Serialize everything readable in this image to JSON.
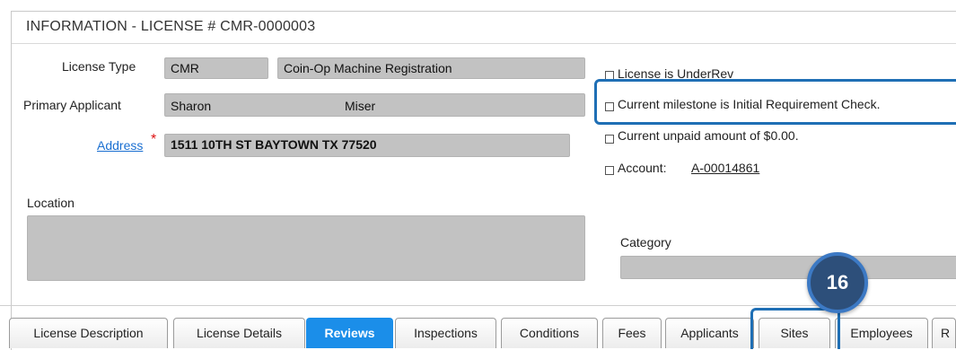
{
  "header": {
    "title": "INFORMATION - LICENSE # CMR-0000003"
  },
  "form": {
    "license_type_label": "License Type",
    "license_type_code": "CMR",
    "license_type_name": "Coin-Op Machine Registration",
    "primary_applicant_label": "Primary Applicant",
    "applicant_first": "Sharon",
    "applicant_last": "Miser",
    "address_label": "Address",
    "address_required_marker": "*",
    "address_value": "1511 10TH ST BAYTOWN TX 77520",
    "location_label": "Location",
    "location_value": "",
    "category_label": "Category",
    "category_value": ""
  },
  "status_list": {
    "item1": "License is UnderRev",
    "item2": "Current milestone is Initial Requirement Check.",
    "item3": "Current unpaid amount of $0.00.",
    "item4_label": "Account:",
    "item4_link": "A-00014861"
  },
  "tabs": [
    {
      "label": "License Description"
    },
    {
      "label": "License Details"
    },
    {
      "label": "Reviews"
    },
    {
      "label": "Inspections"
    },
    {
      "label": "Conditions"
    },
    {
      "label": "Fees"
    },
    {
      "label": "Applicants"
    },
    {
      "label": "Sites"
    },
    {
      "label": "Employees"
    },
    {
      "label": "R"
    }
  ],
  "annotation": {
    "step_number": "16"
  },
  "colors": {
    "accent": "#1b8ee9",
    "highlight": "#1f6fb5",
    "badge": "#2d4f7a",
    "field_bg": "#c2c2c2"
  }
}
